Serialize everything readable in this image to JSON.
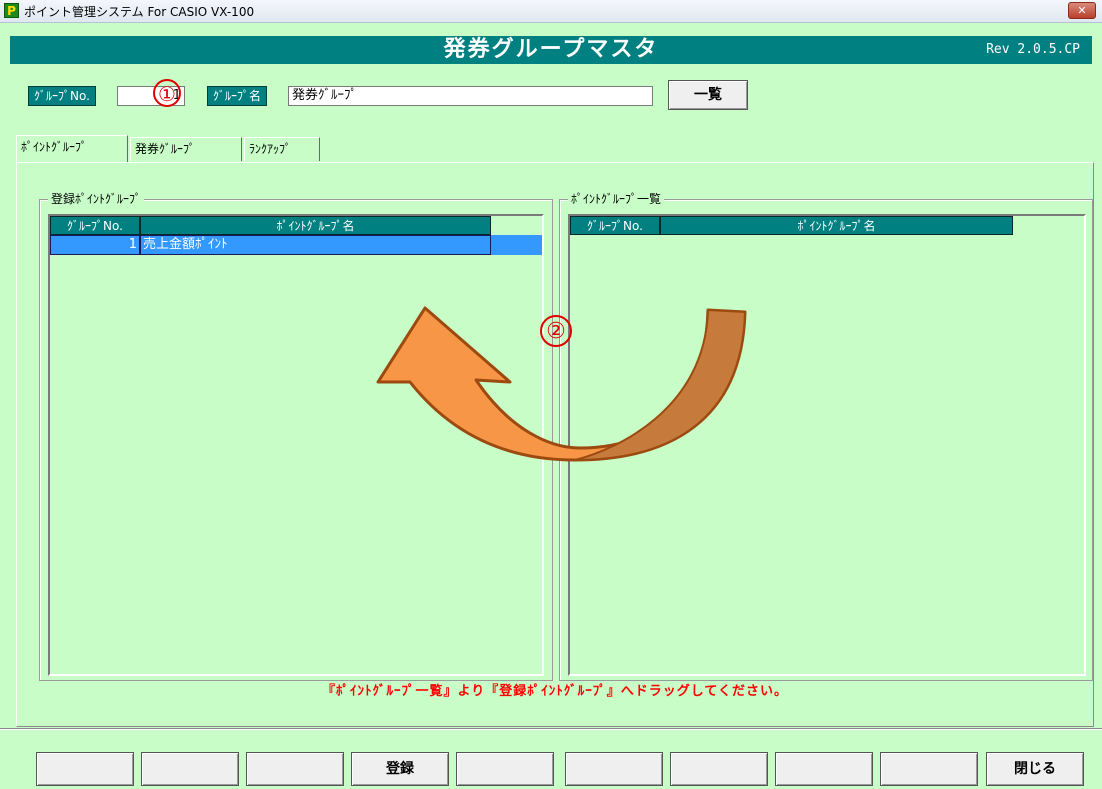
{
  "window": {
    "title": "ポイント管理システム For CASIO VX-100",
    "icon_letter": "P",
    "close_symbol": "✕"
  },
  "banner": {
    "title": "発券グループマスタ",
    "revision": "Rev 2.0.5.CP",
    "color": "#008080"
  },
  "header": {
    "group_no_label": "ｸﾞﾙｰﾌﾟNo.",
    "group_no_value": "1",
    "group_name_label": "ｸﾞﾙｰﾌﾟ名",
    "group_name_value": "発券ｸﾞﾙｰﾌﾟ",
    "list_button": "一覧"
  },
  "annotations": {
    "step1": "①",
    "step2": "②"
  },
  "tabs": [
    {
      "label": "ﾎﾟｲﾝﾄｸﾞﾙｰﾌﾟ",
      "active": true
    },
    {
      "label": "発券ｸﾞﾙｰﾌﾟ",
      "active": false
    },
    {
      "label": "ﾗﾝｸｱｯﾌﾟ",
      "active": false
    }
  ],
  "registered": {
    "title": "登録ﾎﾟｲﾝﾄｸﾞﾙｰﾌﾟ",
    "columns": [
      "ｸﾞﾙｰﾌﾟNo.",
      "ﾎﾟｲﾝﾄｸﾞﾙｰﾌﾟ名"
    ],
    "rows": [
      {
        "no": "1",
        "name": "売上金額ﾎﾟｲﾝﾄ",
        "selected": true
      }
    ]
  },
  "available": {
    "title": "ﾎﾟｲﾝﾄｸﾞﾙｰﾌﾟ一覧",
    "columns": [
      "ｸﾞﾙｰﾌﾟNo.",
      "ﾎﾟｲﾝﾄｸﾞﾙｰﾌﾟ名"
    ],
    "rows": []
  },
  "hint": "『ﾎﾟｲﾝﾄｸﾞﾙｰﾌﾟ一覧』より『登録ﾎﾟｲﾝﾄｸﾞﾙｰﾌﾟ』へドラッグしてください。",
  "function_keys": [
    "",
    "",
    "",
    "登録",
    "",
    "",
    "",
    "",
    "",
    "閉じる"
  ],
  "colors": {
    "background": "#c8fdc8",
    "header_teal": "#008080",
    "selection": "#3399ff",
    "hint_red": "#ff0000",
    "arrow_orange": "#f79646"
  }
}
